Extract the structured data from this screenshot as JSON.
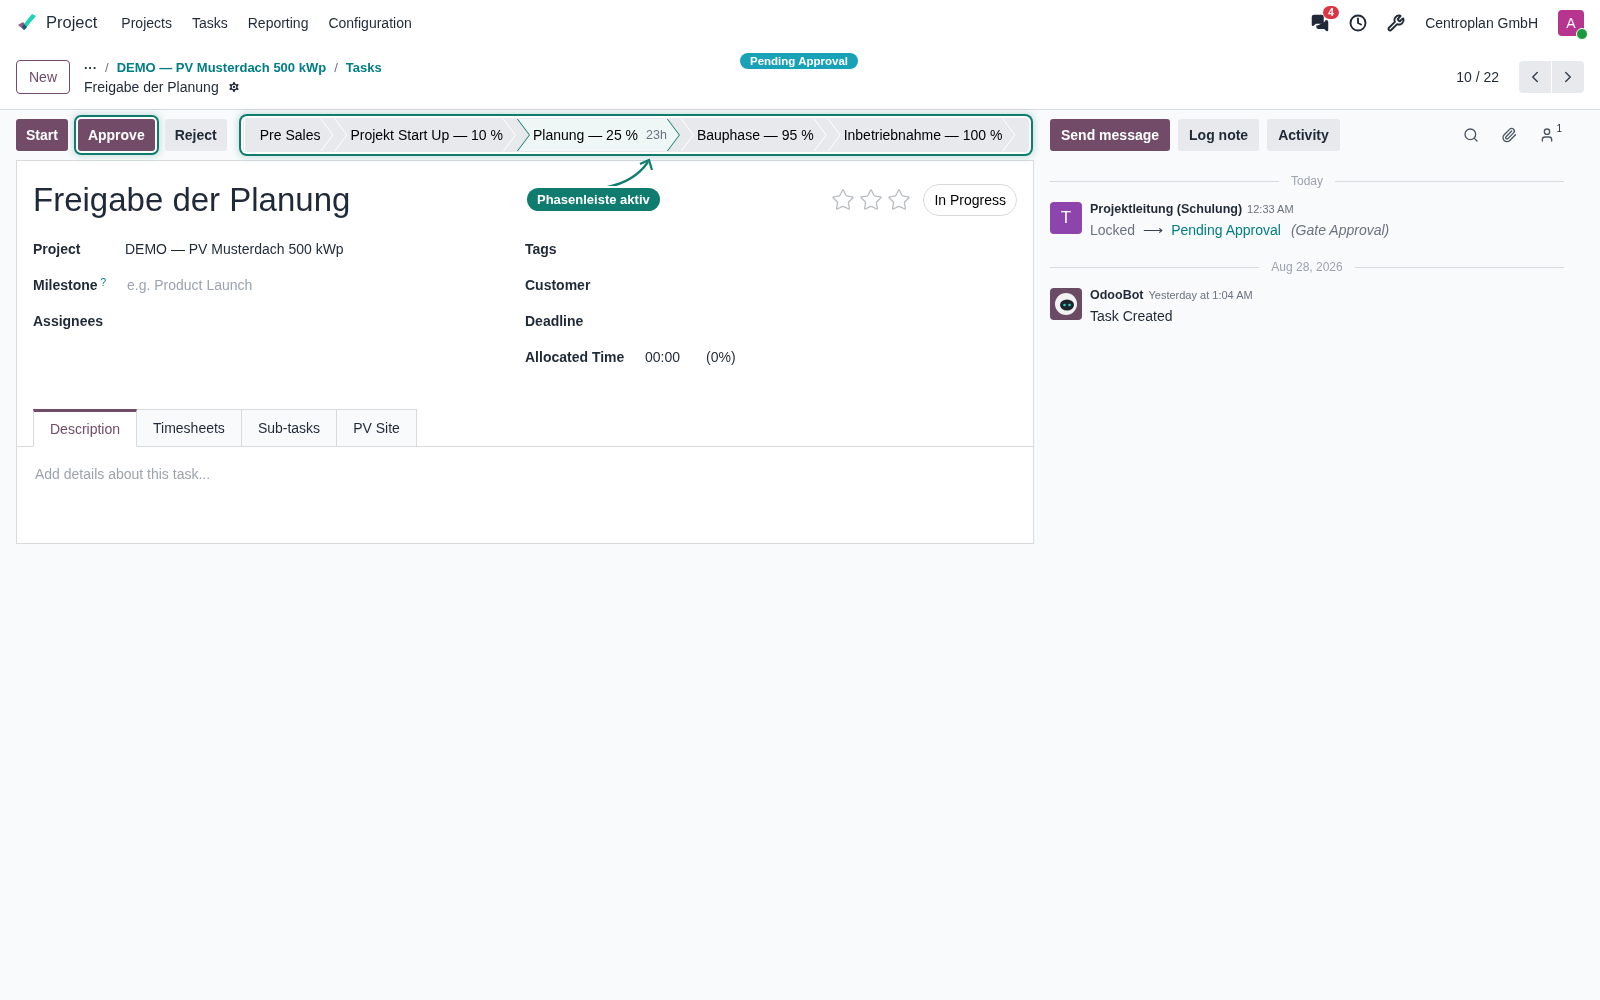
{
  "navbar": {
    "app_name": "Project",
    "menu": [
      "Projects",
      "Tasks",
      "Reporting",
      "Configuration"
    ],
    "messages_badge": "4",
    "company": "Centroplan GmbH",
    "avatar_letter": "A",
    "online": true
  },
  "control_panel": {
    "new_button": "New",
    "breadcrumbs": [
      "DEMO — PV Musterdach 500 kWp",
      "Tasks"
    ],
    "separator": "/",
    "ellipsis": "···",
    "record_name": "Freigabe der Planung",
    "state_badge": "Pending Approval",
    "pager": "10 / 22"
  },
  "action_buttons": [
    {
      "label": "Start",
      "kind": "primary",
      "highlighted": false
    },
    {
      "label": "Approve",
      "kind": "primary",
      "highlighted": true
    },
    {
      "label": "Reject",
      "kind": "secondary",
      "highlighted": false
    }
  ],
  "statusbar": {
    "highlighted": true,
    "stages": [
      {
        "label": "Pre Sales",
        "selected": false
      },
      {
        "label": "Projekt Start Up — 10 %",
        "selected": false
      },
      {
        "label": "Planung — 25 %",
        "hours": "23h",
        "selected": true
      },
      {
        "label": "Bauphase — 95 %",
        "selected": false
      },
      {
        "label": "Inbetriebnahme — 100 %",
        "selected": false
      }
    ]
  },
  "annotation": {
    "text": "Phasenleiste aktiv"
  },
  "form": {
    "title": "Freigabe der Planung",
    "stars": 0,
    "state_button": "In Progress",
    "left_fields": [
      {
        "label": "Project",
        "value": "DEMO — PV Musterdach 500 kWp"
      },
      {
        "label": "Milestone",
        "help": "?",
        "placeholder": "e.g. Product Launch"
      },
      {
        "label": "Assignees"
      }
    ],
    "right_fields": [
      {
        "label": "Tags"
      },
      {
        "label": "Customer"
      },
      {
        "label": "Deadline"
      },
      {
        "label": "Allocated Time",
        "value": "00:00",
        "extra": "(0%)"
      }
    ],
    "tabs": [
      {
        "label": "Description",
        "selected": true
      },
      {
        "label": "Timesheets",
        "selected": false
      },
      {
        "label": "Sub-tasks",
        "selected": false
      },
      {
        "label": "PV Site",
        "selected": false
      }
    ],
    "description_placeholder": "Add details about this task..."
  },
  "chatter": {
    "buttons": [
      {
        "label": "Send message",
        "kind": "primary"
      },
      {
        "label": "Log note",
        "kind": "secondary"
      },
      {
        "label": "Activity",
        "kind": "secondary"
      }
    ],
    "followers_count": "1",
    "groups": [
      {
        "date": "Today",
        "messages": [
          {
            "author": "Projektleitung (Schulung)",
            "time": "12:33 AM",
            "kind": "letter",
            "avatar_letter": "T",
            "color": "#8e44ad",
            "from": "Locked",
            "arrow": "⟶",
            "to": "Pending Approval",
            "note": "(Gate Approval)"
          }
        ]
      },
      {
        "date": "Aug 28, 2026",
        "messages": [
          {
            "author": "OdooBot",
            "time": "Yesterday at 1:04 AM",
            "kind": "bot",
            "body": "Task Created"
          }
        ]
      }
    ]
  }
}
